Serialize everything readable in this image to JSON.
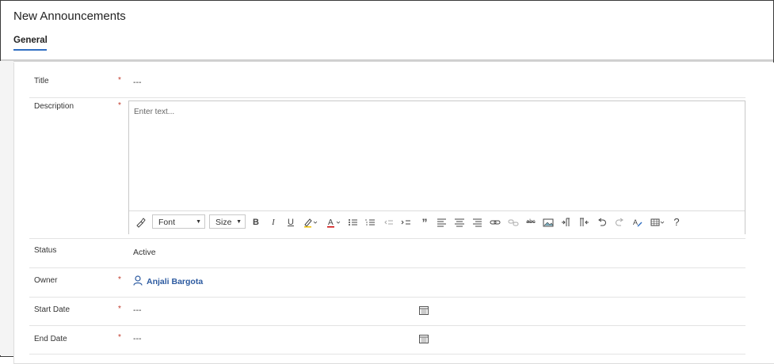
{
  "header": {
    "title": "New Announcements",
    "tab": "General"
  },
  "form": {
    "title": {
      "label": "Title",
      "required": "*",
      "value": "---"
    },
    "description": {
      "label": "Description",
      "required": "*",
      "placeholder": "Enter text..."
    },
    "status": {
      "label": "Status",
      "value": "Active"
    },
    "owner": {
      "label": "Owner",
      "required": "*",
      "value": "Anjali Bargota"
    },
    "start_date": {
      "label": "Start Date",
      "required": "*",
      "value": "---"
    },
    "end_date": {
      "label": "End Date",
      "required": "*",
      "value": "---"
    }
  },
  "toolbar": {
    "font_label": "Font",
    "size_label": "Size",
    "bold": "B",
    "italic": "I",
    "underline": "U",
    "quote": "”",
    "help": "?"
  },
  "icons": [
    "format-painter-icon",
    "bold-icon",
    "italic-icon",
    "underline-icon",
    "highlight-icon",
    "font-color-icon",
    "bullets-icon",
    "numbering-icon",
    "outdent-icon",
    "indent-icon",
    "blockquote-icon",
    "align-left-icon",
    "align-center-icon",
    "align-right-icon",
    "link-icon",
    "unlink-icon",
    "strikethrough-icon",
    "image-icon",
    "ltr-icon",
    "rtl-icon",
    "undo-icon",
    "redo-icon",
    "clear-format-icon",
    "table-icon",
    "help-icon",
    "calendar-icon",
    "person-icon"
  ]
}
